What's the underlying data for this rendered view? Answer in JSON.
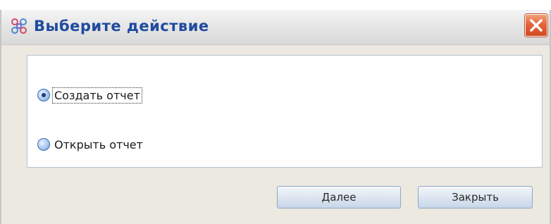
{
  "dialog": {
    "title": "Выберите действие",
    "close_icon": "close-icon",
    "app_icon": "app-grid-icon"
  },
  "options": [
    {
      "label": "Создать отчет",
      "selected": true
    },
    {
      "label": "Открыть отчет",
      "selected": false
    }
  ],
  "buttons": {
    "next_label": "Далее",
    "close_label": "Закрыть"
  },
  "colors": {
    "title_text": "#1f4aa0",
    "close_button": "#e4643a",
    "radio_fill": "#a9c8ef"
  }
}
